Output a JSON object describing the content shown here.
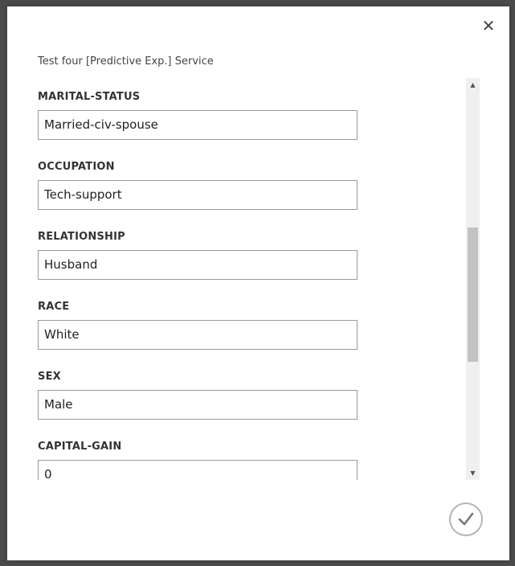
{
  "dialog": {
    "title": "Test four [Predictive Exp.] Service",
    "close_icon": "close-icon",
    "confirm_icon": "checkmark-icon"
  },
  "fields": [
    {
      "label": "MARITAL-STATUS",
      "value": "Married-civ-spouse"
    },
    {
      "label": "OCCUPATION",
      "value": "Tech-support"
    },
    {
      "label": "RELATIONSHIP",
      "value": "Husband"
    },
    {
      "label": "RACE",
      "value": "White"
    },
    {
      "label": "SEX",
      "value": "Male"
    },
    {
      "label": "CAPITAL-GAIN",
      "value": "0"
    }
  ],
  "scrollbar": {
    "position_fraction": 0.42
  },
  "colors": {
    "overlay": "#4a4a4a",
    "dialog_bg": "#ffffff",
    "input_border": "#9a9a9a",
    "scroll_thumb": "#c2c2c2"
  }
}
